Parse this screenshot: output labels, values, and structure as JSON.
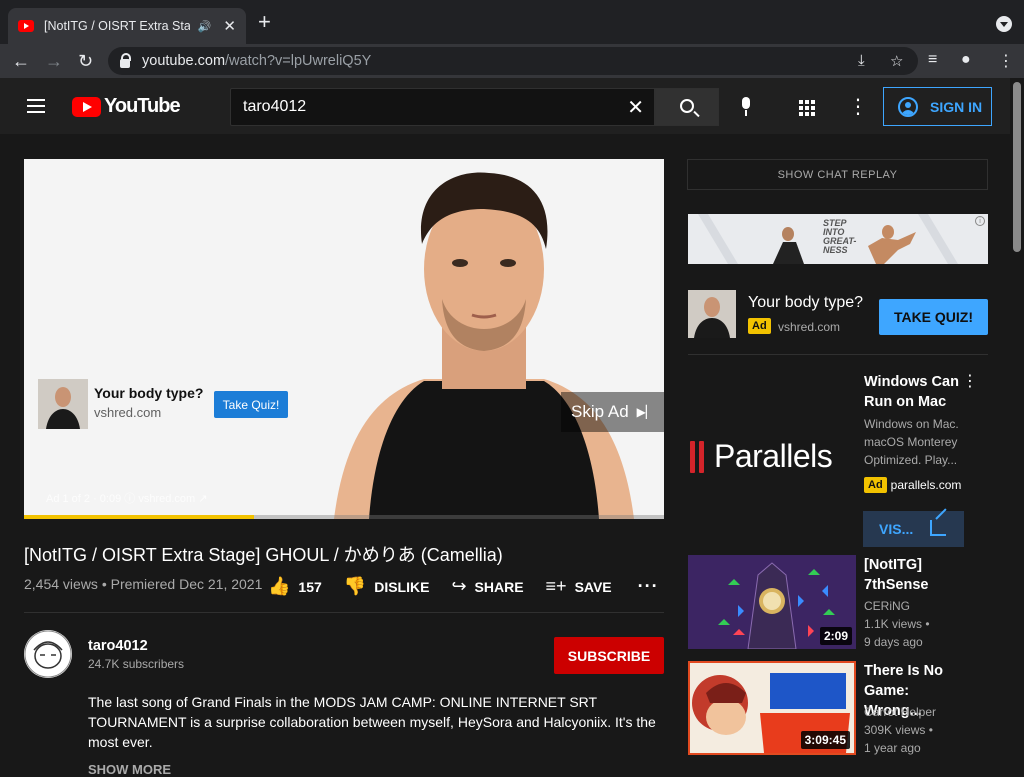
{
  "browser": {
    "tab_title": "[NotITG / OISRT Extra Stag",
    "url_host": "youtube.com",
    "url_path": "/watch?v=lpUwreliQ5Y"
  },
  "header": {
    "logo_text": "YouTube",
    "search_value": "taro4012",
    "signin_label": "SIGN IN"
  },
  "player": {
    "ad_title": "Your body type?",
    "ad_domain": "vshred.com",
    "ad_button": "Take Quiz!",
    "skip_label": "Skip Ad",
    "ad_footer": "Ad 1 of 2 · 0:09 ⓘ vshred.com ↗",
    "ad_progress": 0.36,
    "ad_progress_color": "#f2c200"
  },
  "video": {
    "title": "[NotITG / OISRT Extra Stage] GHOUL / かめりあ (Camellia)",
    "meta": "2,454 views • Premiered Dec 21, 2021",
    "likes": "157",
    "dislike_label": "DISLIKE",
    "share_label": "SHARE",
    "save_label": "SAVE"
  },
  "channel": {
    "name": "taro4012",
    "subscribers": "24.7K subscribers",
    "subscribe_label": "SUBSCRIBE",
    "description": "The last song of Grand Finals in the MODS JAM CAMP: ONLINE INTERNET SRT TOURNAMENT is a surprise collaboration between myself, HeySora and Halcyoniix. It's the most ever.",
    "show_more": "SHOW MORE"
  },
  "sidebar": {
    "chat_replay": "SHOW CHAT REPLAY",
    "banner_text": "STEP INTO GREAT- NESS",
    "ad": {
      "title": "Your body type?",
      "badge": "Ad",
      "domain": "vshred.com",
      "button": "TAKE QUIZ!"
    },
    "parallels": {
      "logo": "Parallels",
      "title": "Windows Can Run on Mac",
      "description": "Windows on Mac. macOS Monterey Optimized. Play...",
      "badge": "Ad",
      "domain": "parallels.com",
      "button": "VIS..."
    },
    "recommendations": [
      {
        "title": "[NotITG] 7thSense",
        "channel": "CERiNG",
        "views": "1.1K views •",
        "age": "9 days ago",
        "duration": "2:09"
      },
      {
        "title": "There Is No Game: Wrong...",
        "channel": "Carrot Helper",
        "views": "309K views •",
        "age": "1 year ago",
        "duration": "3:09:45"
      }
    ]
  }
}
